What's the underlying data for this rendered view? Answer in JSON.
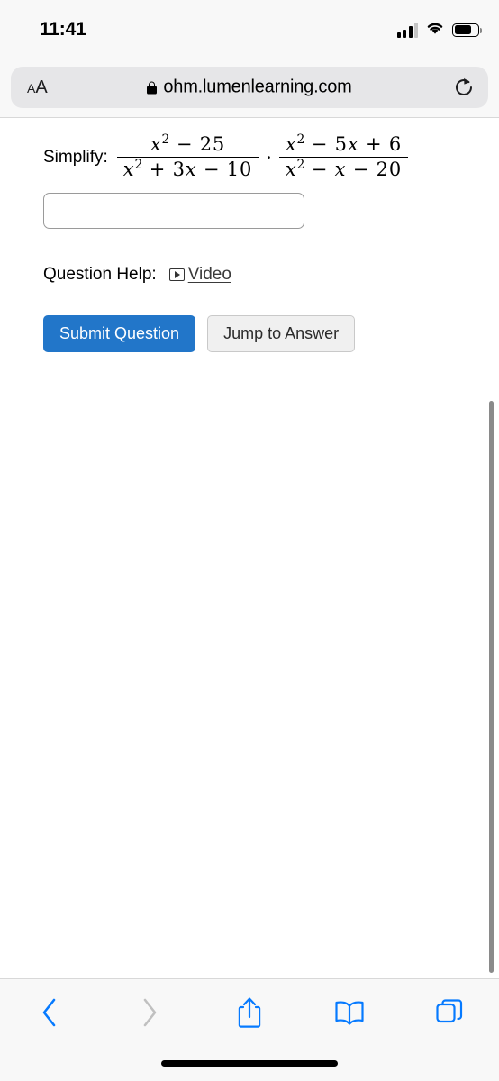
{
  "status_bar": {
    "time": "11:41",
    "cellular_icon": "cellular-signal-icon",
    "wifi_icon": "wifi-icon",
    "battery_icon": "battery-icon"
  },
  "browser": {
    "aa_small": "A",
    "aa_big": "A",
    "aa_label": "AA",
    "lock_icon": "lock-icon",
    "url": "ohm.lumenlearning.com",
    "reload_icon": "reload-icon",
    "toolbar": {
      "back_icon": "chevron-left-icon",
      "forward_icon": "chevron-right-icon",
      "share_icon": "share-icon",
      "bookmarks_icon": "book-icon",
      "tabs_icon": "tabs-icon"
    }
  },
  "question": {
    "prompt": "Simplify:",
    "expression": {
      "fraction1": {
        "numerator": "x² − 25",
        "denominator": "x² + 3x − 10"
      },
      "operator": "·",
      "fraction2": {
        "numerator": "x² − 5x + 6",
        "denominator": "x² − x − 20"
      }
    },
    "answer_value": "",
    "answer_placeholder": "",
    "help_label": "Question Help:",
    "video_link_text": "Video",
    "video_icon": "video-play-icon",
    "submit_button": "Submit Question",
    "jump_button": "Jump to Answer"
  },
  "colors": {
    "primary_blue": "#2276c9",
    "toolbar_blue": "#067aff",
    "disabled_gray": "#c0c0c0",
    "chrome_bg": "#f8f8f8",
    "url_bar_bg": "#e6e6e8"
  }
}
